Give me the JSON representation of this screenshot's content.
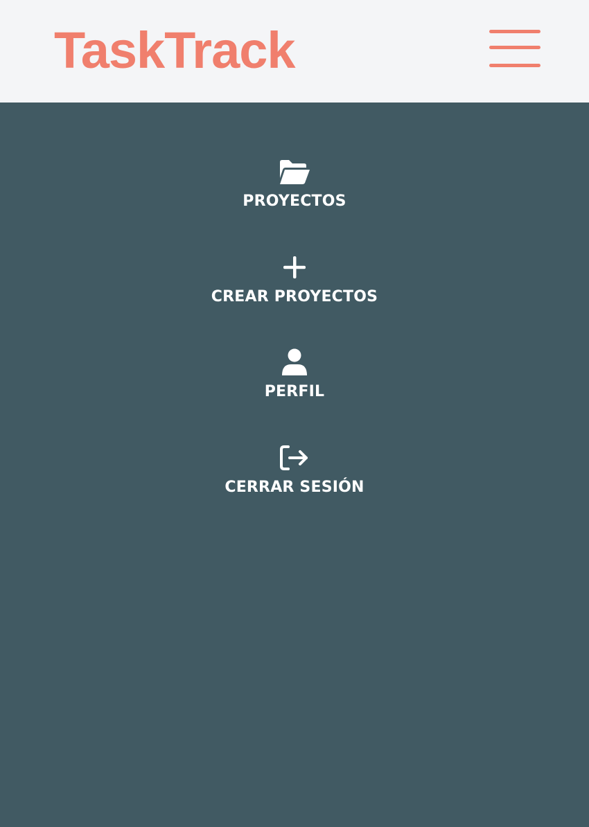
{
  "header": {
    "logo_text": "TaskTrack",
    "menu_icon": "hamburger-menu-icon"
  },
  "nav": {
    "items": [
      {
        "label": "PROYECTOS",
        "icon": "folder-open-icon"
      },
      {
        "label": "CREAR PROYECTOS",
        "icon": "plus-icon"
      },
      {
        "label": "PERFIL",
        "icon": "user-icon"
      },
      {
        "label": "CERRAR SESIÓN",
        "icon": "logout-icon"
      }
    ]
  },
  "colors": {
    "brand": "#f07f6d",
    "header_bg": "#f4f5f7",
    "panel_bg": "#415a63",
    "nav_text": "#ffffff"
  }
}
